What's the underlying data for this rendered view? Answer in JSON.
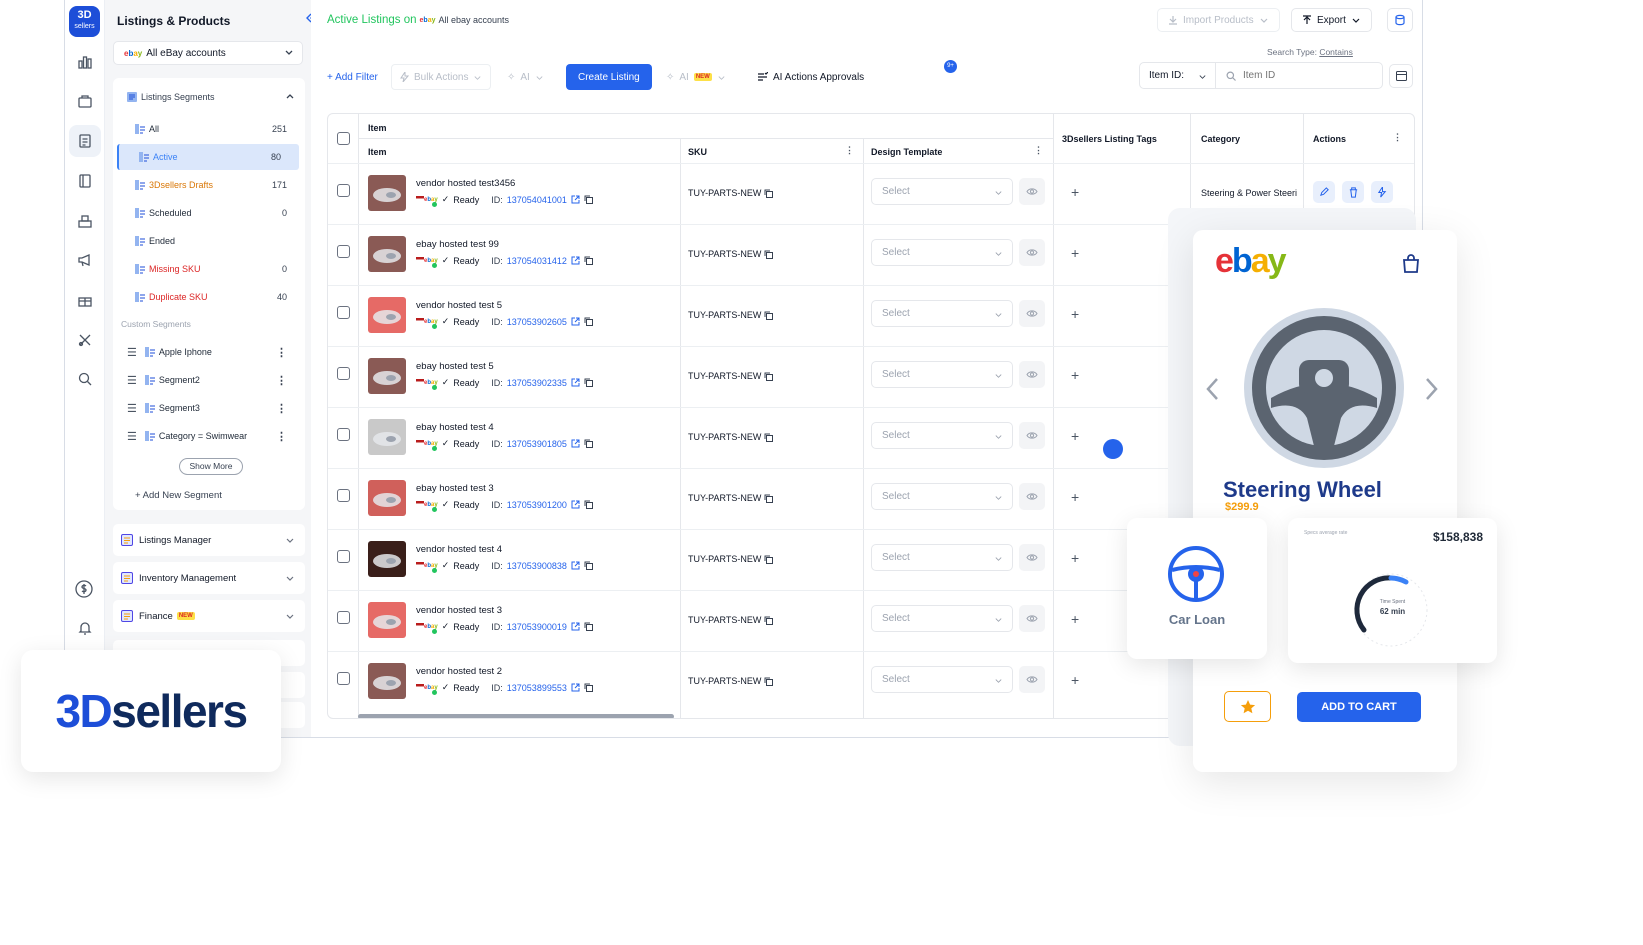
{
  "app": {
    "logo_top": "3D",
    "logo_bottom": "sellers"
  },
  "sidebar": {
    "title": "Listings & Products",
    "account": "All eBay accounts",
    "segments_title": "Listings Segments",
    "segments": [
      {
        "label": "All",
        "count": "251",
        "color": "#1f2937"
      },
      {
        "label": "Active",
        "count": "80",
        "color": "#3b82f6"
      },
      {
        "label": "3Dsellers Drafts",
        "count": "171",
        "color": "#d97706"
      },
      {
        "label": "Scheduled",
        "count": "0",
        "color": "#1f2937"
      },
      {
        "label": "Ended",
        "count": "",
        "color": "#1f2937"
      },
      {
        "label": "Missing SKU",
        "count": "0",
        "color": "#dc2626"
      },
      {
        "label": "Duplicate SKU",
        "count": "40",
        "color": "#dc2626"
      }
    ],
    "custom_title": "Custom Segments",
    "custom": [
      "Apple Iphone",
      "Segment2",
      "Segment3",
      "Category = Swimwear"
    ],
    "show_more": "Show More",
    "add_segment": "+ Add New Segment",
    "menus": [
      "Listings Manager",
      "Inventory Management",
      "Finance"
    ],
    "new_badge": "NEW"
  },
  "header": {
    "crumb": "Active Listings on",
    "crumb_account": "All ebay accounts",
    "import": "Import Products",
    "export": "Export",
    "search_type_label": "Search Type:",
    "search_type_value": "Contains"
  },
  "toolbar": {
    "add_filter": "+ Add Filter",
    "bulk": "Bulk Actions",
    "ai": "AI",
    "create": "Create Listing",
    "ai2": "AI",
    "approvals": "AI Actions Approvals",
    "approvals_badge": "9+",
    "item_id_select": "Item ID:",
    "item_id_placeholder": "Item ID"
  },
  "grid": {
    "group_header": "Item",
    "columns": [
      "Item",
      "SKU",
      "Design Template",
      "3Dsellers Listing Tags",
      "Category",
      "Actions"
    ],
    "ready": "Ready",
    "id_label": "ID:",
    "select_placeholder": "Select",
    "rows": [
      {
        "name": "vendor hosted test3456",
        "id": "137054041001",
        "sku": "TUY-PARTS-NEW",
        "category": "Steering & Power Steeri",
        "thumb": "#8a5a55"
      },
      {
        "name": "ebay hosted test 99",
        "id": "137054031412",
        "sku": "TUY-PARTS-NEW",
        "category": "",
        "thumb": "#8a5a55"
      },
      {
        "name": "vendor hosted test 5",
        "id": "137053902605",
        "sku": "TUY-PARTS-NEW",
        "category": "",
        "thumb": "#e66a66"
      },
      {
        "name": "ebay hosted test 5",
        "id": "137053902335",
        "sku": "TUY-PARTS-NEW",
        "category": "",
        "thumb": "#8a5a55"
      },
      {
        "name": "ebay hosted test 4",
        "id": "137053901805",
        "sku": "TUY-PARTS-NEW",
        "category": "",
        "thumb": "#c9c9c9"
      },
      {
        "name": "ebay hosted test 3",
        "id": "137053901200",
        "sku": "TUY-PARTS-NEW",
        "category": "",
        "thumb": "#d0605b"
      },
      {
        "name": "vendor hosted test 4",
        "id": "137053900838",
        "sku": "TUY-PARTS-NEW",
        "category": "",
        "thumb": "#3a1f1a"
      },
      {
        "name": "vendor hosted test 3",
        "id": "137053900019",
        "sku": "TUY-PARTS-NEW",
        "category": "",
        "thumb": "#e66a66"
      },
      {
        "name": "vendor hosted test 2",
        "id": "137053899553",
        "sku": "TUY-PARTS-NEW",
        "category": "",
        "thumb": "#8a5a55"
      }
    ]
  },
  "brand": {
    "name": "3Dsellers"
  },
  "promo": {
    "store": "ebay",
    "product": "Steering Wheel",
    "price": "$299.9",
    "loan": "Car Loan",
    "stat_caption": "Specs average rate",
    "stat_value": "$158,838",
    "gauge_label": "Time Spent",
    "gauge_value": "62 min",
    "add_to_cart": "ADD TO CART"
  },
  "colors": {
    "accent": "#2563eb",
    "active_green": "#22c55e"
  }
}
